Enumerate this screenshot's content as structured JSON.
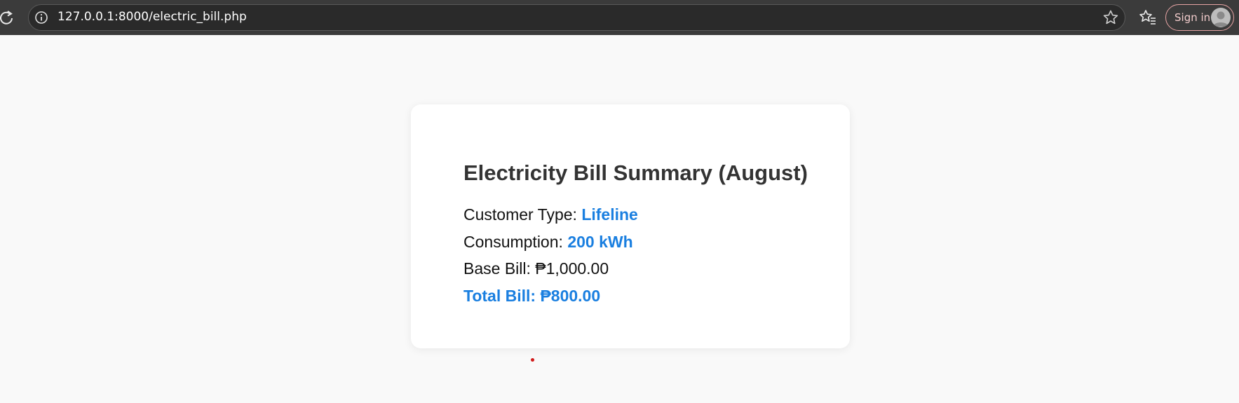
{
  "browser": {
    "url": "127.0.0.1:8000/electric_bill.php",
    "sign_in_label": "Sign in",
    "icons": [
      "reload-icon",
      "site-info-icon",
      "bookmark-star-icon",
      "favorites-icon",
      "avatar-icon"
    ]
  },
  "bill": {
    "title": "Electricity Bill Summary (August)",
    "customer_type_label": "Customer Type:",
    "customer_type_value": "Lifeline",
    "consumption_label": "Consumption:",
    "consumption_value": "200 kWh",
    "base_bill_label": "Base Bill:",
    "base_bill_value": "₱1,000.00",
    "total_bill_label": "Total Bill:",
    "total_bill_value": "₱800.00"
  },
  "colors": {
    "accent": "#1a7fe0",
    "title": "#333333",
    "page_bg": "#f9f9f9",
    "toolbar_bg": "#3b3b3b"
  }
}
